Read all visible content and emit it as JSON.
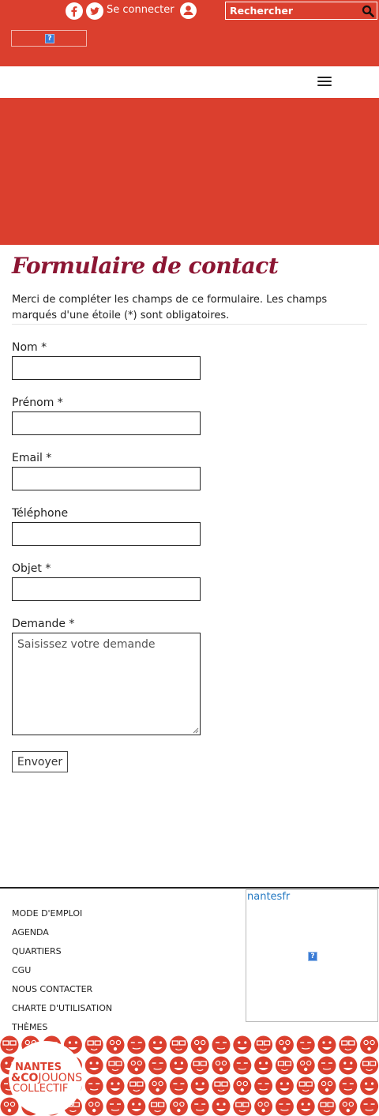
{
  "header": {
    "social": [
      {
        "name": "facebook",
        "icon": "facebook-icon"
      },
      {
        "name": "twitter",
        "icon": "twitter-icon"
      }
    ],
    "login_label": "Se connecter",
    "user_icon": "user-icon",
    "search_placeholder": "Rechercher",
    "search_icon": "search-icon",
    "logo_icon": "broken-image-icon",
    "menu_icon": "hamburger-menu-icon"
  },
  "colors": {
    "brand_red": "#db3f2e",
    "title_color": "#8c1633",
    "link_blue": "#2479c2"
  },
  "page": {
    "title": "Formulaire de contact",
    "intro": "Merci de compléter les champs de ce formulaire. Les champs marqués d'une étoile (*) sont obligatoires."
  },
  "form": {
    "nom_label": "Nom *",
    "prenom_label": "Prénom *",
    "email_label": "Email *",
    "telephone_label": "Téléphone",
    "objet_label": "Objet *",
    "demande_label": "Demande *",
    "demande_placeholder": "Saisissez votre demande",
    "submit_label": "Envoyer"
  },
  "footer": {
    "links": [
      "MODE D'EMPLOI",
      "AGENDA",
      "QUARTIERS",
      "CGU",
      "NOUS CONTACTER",
      "CHARTE D'UTILISATION",
      "THÈMES"
    ],
    "widget_label": "nantesfr",
    "widget_icon": "broken-image-icon",
    "badge": {
      "line1": "NANTES",
      "line2_bold": "&CO",
      "line2_rest": "JOUONS",
      "line3": "COLLECTIF"
    }
  }
}
